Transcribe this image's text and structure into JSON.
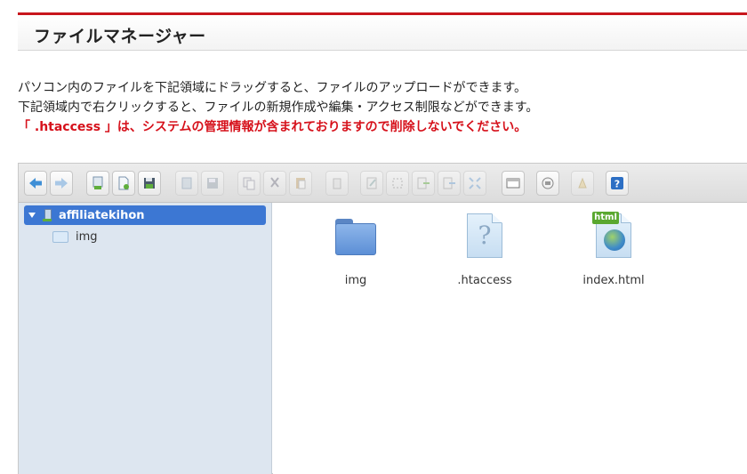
{
  "header": {
    "title": "ファイルマネージャー"
  },
  "notes": {
    "line1": "パソコン内のファイルを下記領域にドラッグすると、ファイルのアップロードができます。",
    "line2": "下記領域内で右クリックすると、ファイルの新規作成や編集・アクセス制限などができます。",
    "warning": "「 .htaccess 」は、システムの管理情報が含まれておりますので削除しないでください。"
  },
  "toolbar": {
    "groups": [
      [
        "back-icon",
        "forward-icon"
      ],
      [
        "upload-icon",
        "new-file-icon",
        "save-icon"
      ],
      [
        "open-icon",
        "disk-icon"
      ],
      [
        "copy-icon",
        "cut-icon",
        "paste-icon"
      ],
      [
        "delete-icon"
      ],
      [
        "rename-icon",
        "select-icon",
        "move-in-icon",
        "move-out-icon",
        "fullscreen-icon"
      ],
      [
        "view-icon"
      ],
      [
        "info-icon"
      ],
      [
        "permission-icon"
      ],
      [
        "help-icon"
      ]
    ],
    "colors": {
      "accent": "#3c77d3",
      "help": "#2d6fc4",
      "back": "#3f8fd6"
    }
  },
  "sidebar": {
    "root": {
      "label": "affiliatekihon",
      "icon": "server-icon"
    },
    "children": [
      {
        "label": "img",
        "icon": "folder-icon"
      }
    ]
  },
  "files": [
    {
      "name": "img",
      "icon": "folder-icon"
    },
    {
      "name": ".htaccess",
      "icon": "unknown-file-icon"
    },
    {
      "name": "index.html",
      "icon": "html-file-icon"
    }
  ]
}
